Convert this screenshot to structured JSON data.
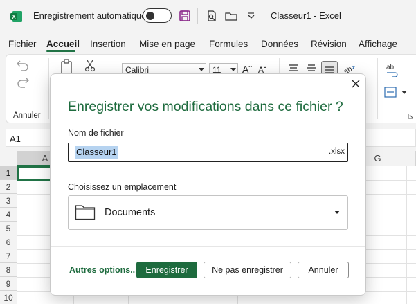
{
  "titlebar": {
    "autosave_label": "Enregistrement automatique",
    "doc_title": "Classeur1  -  Excel"
  },
  "menu": {
    "items": [
      "Fichier",
      "Accueil",
      "Insertion",
      "Mise en page",
      "Formules",
      "Données",
      "Révision",
      "Affichage"
    ],
    "active": "Accueil"
  },
  "ribbon": {
    "undo_group_label": "Annuler",
    "font_name": "Calibri",
    "font_size": "11"
  },
  "formula_bar": {
    "name_box": "A1"
  },
  "grid": {
    "columns": [
      "A",
      "G"
    ],
    "rows": [
      "1",
      "2",
      "3",
      "4",
      "5",
      "6",
      "7",
      "8",
      "9",
      "10"
    ]
  },
  "dialog": {
    "title": "Enregistrer vos modifications dans ce fichier ?",
    "filename_label": "Nom de fichier",
    "filename_value": "Classeur1",
    "filename_ext": ".xlsx",
    "location_label": "Choisissez un emplacement",
    "location_value": "Documents",
    "other_options": "Autres options...",
    "save_button": "Enregistrer",
    "dont_save_button": "Ne pas enregistrer",
    "cancel_button": "Annuler"
  },
  "colors": {
    "accent": "#1e6b3e",
    "selection": "#b6d3f0"
  }
}
